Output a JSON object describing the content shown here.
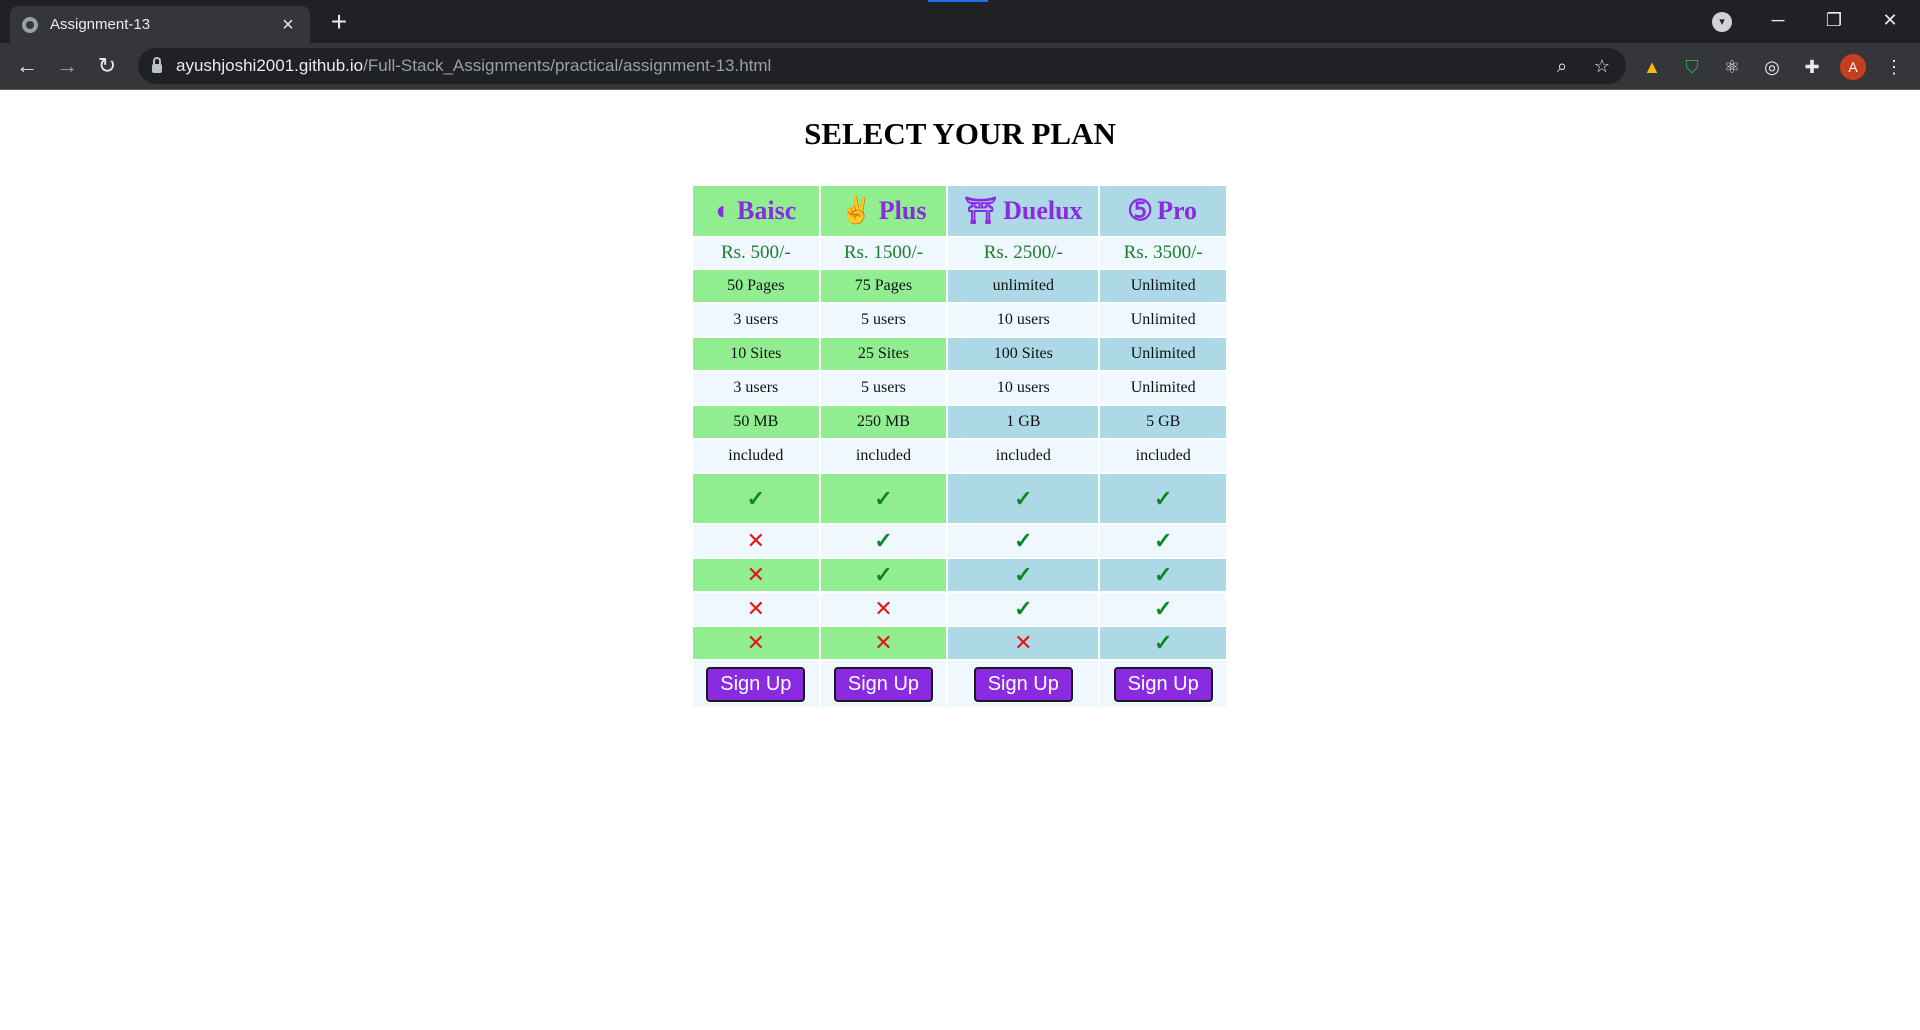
{
  "browser": {
    "tab_title": "Assignment-13",
    "url_host": "ayushjoshi2001.github.io",
    "url_path": "/Full-Stack_Assignments/practical/assignment-13.html",
    "profile_initial": "A"
  },
  "page": {
    "title": "SELECT YOUR PLAN"
  },
  "plans": [
    {
      "name": "Baisc",
      "icon": "half-circle-icon",
      "glyph": "◐",
      "price": "Rs. 500/-",
      "signup": "Sign Up"
    },
    {
      "name": "Plus",
      "icon": "victory-hand-icon",
      "glyph": "✌",
      "price": "Rs. 1500/-",
      "signup": "Sign Up"
    },
    {
      "name": "Duelux",
      "icon": "archway-icon",
      "glyph": "⛩",
      "price": "Rs. 2500/-",
      "signup": "Sign Up"
    },
    {
      "name": "Pro",
      "icon": "number-five-icon",
      "glyph": "➄",
      "price": "Rs. 3500/-",
      "signup": "Sign Up"
    }
  ],
  "feature_rows": [
    [
      "50 Pages",
      "75 Pages",
      "unlimited",
      "Unlimited"
    ],
    [
      "3 users",
      "5 users",
      "10 users",
      "Unlimited"
    ],
    [
      "10 Sites",
      "25 Sites",
      "100 Sites",
      "Unlimited"
    ],
    [
      "3 users",
      "5 users",
      "10 users",
      "Unlimited"
    ],
    [
      "50 MB",
      "250 MB",
      "1 GB",
      "5 GB"
    ],
    [
      "included",
      "included",
      "included",
      "included"
    ]
  ],
  "check_rows": [
    [
      true,
      true,
      true,
      true
    ],
    [
      false,
      true,
      true,
      true
    ],
    [
      false,
      true,
      true,
      true
    ],
    [
      false,
      false,
      true,
      true
    ],
    [
      false,
      false,
      false,
      true
    ]
  ],
  "colors": {
    "green_cell": "#90ee90",
    "blue_cell": "#add8e6",
    "alt_row": "#f0f8ff",
    "plan_name": "#8a2be2",
    "price": "#1b7f2a",
    "check": "#0a8a1e",
    "cross": "#e01818",
    "button": "#8a2be2"
  },
  "symbols": {
    "yes": "✓",
    "no": "✕"
  }
}
